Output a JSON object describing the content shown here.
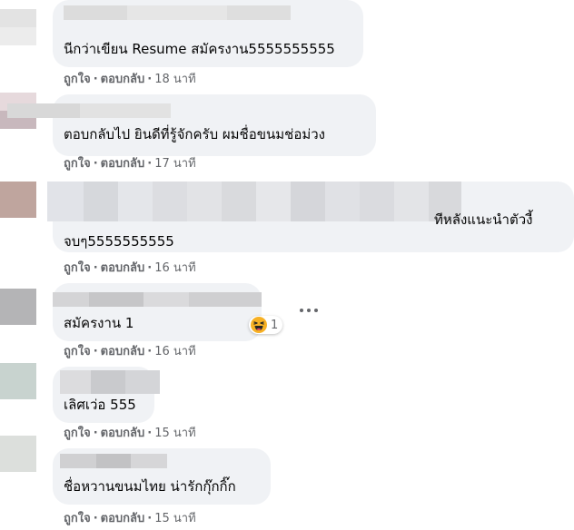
{
  "comments": [
    {
      "text_lines": [
        "นีกว่าเขียน Resume สมัครงาน5555555555"
      ],
      "like": "ถูกใจ",
      "reply": "ตอบกลับ",
      "time": "18 นาที"
    },
    {
      "text_lines": [
        "ตอบกลับไป ยินดีที่รู้จักครับ ผมชื่อขนมช่อม่วง"
      ],
      "like": "ถูกใจ",
      "reply": "ตอบกลับ",
      "time": "17 นาที"
    },
    {
      "text_lines": [
        "ทีหลังแนะนำตัวงี้",
        "จบๆ5555555555"
      ],
      "like": "ถูกใจ",
      "reply": "ตอบกลับ",
      "time": "16 นาที"
    },
    {
      "text_lines": [
        "สมัครงาน 1"
      ],
      "like": "ถูกใจ",
      "reply": "ตอบกลับ",
      "time": "16 นาที",
      "reaction": {
        "icon": "haha-emoji-icon",
        "count": "1"
      }
    },
    {
      "text_lines": [
        "เลิศเว่อ 555"
      ],
      "like": "ถูกใจ",
      "reply": "ตอบกลับ",
      "time": "15 นาที"
    },
    {
      "text_lines": [
        "ชื่อหวานขนมไทย น่ารักกุ๊กกิ๊ก"
      ],
      "like": "ถูกใจ",
      "reply": "ตอบกลับ",
      "time": "15 นาที"
    }
  ],
  "separator": "·",
  "colors": {
    "bubble": "#f0f2f5",
    "action_text": "#65676b",
    "body_text": "#050505"
  },
  "icons": [
    "haha-emoji-icon",
    "more-options-icon",
    "blurred-avatar",
    "blurred-name"
  ]
}
